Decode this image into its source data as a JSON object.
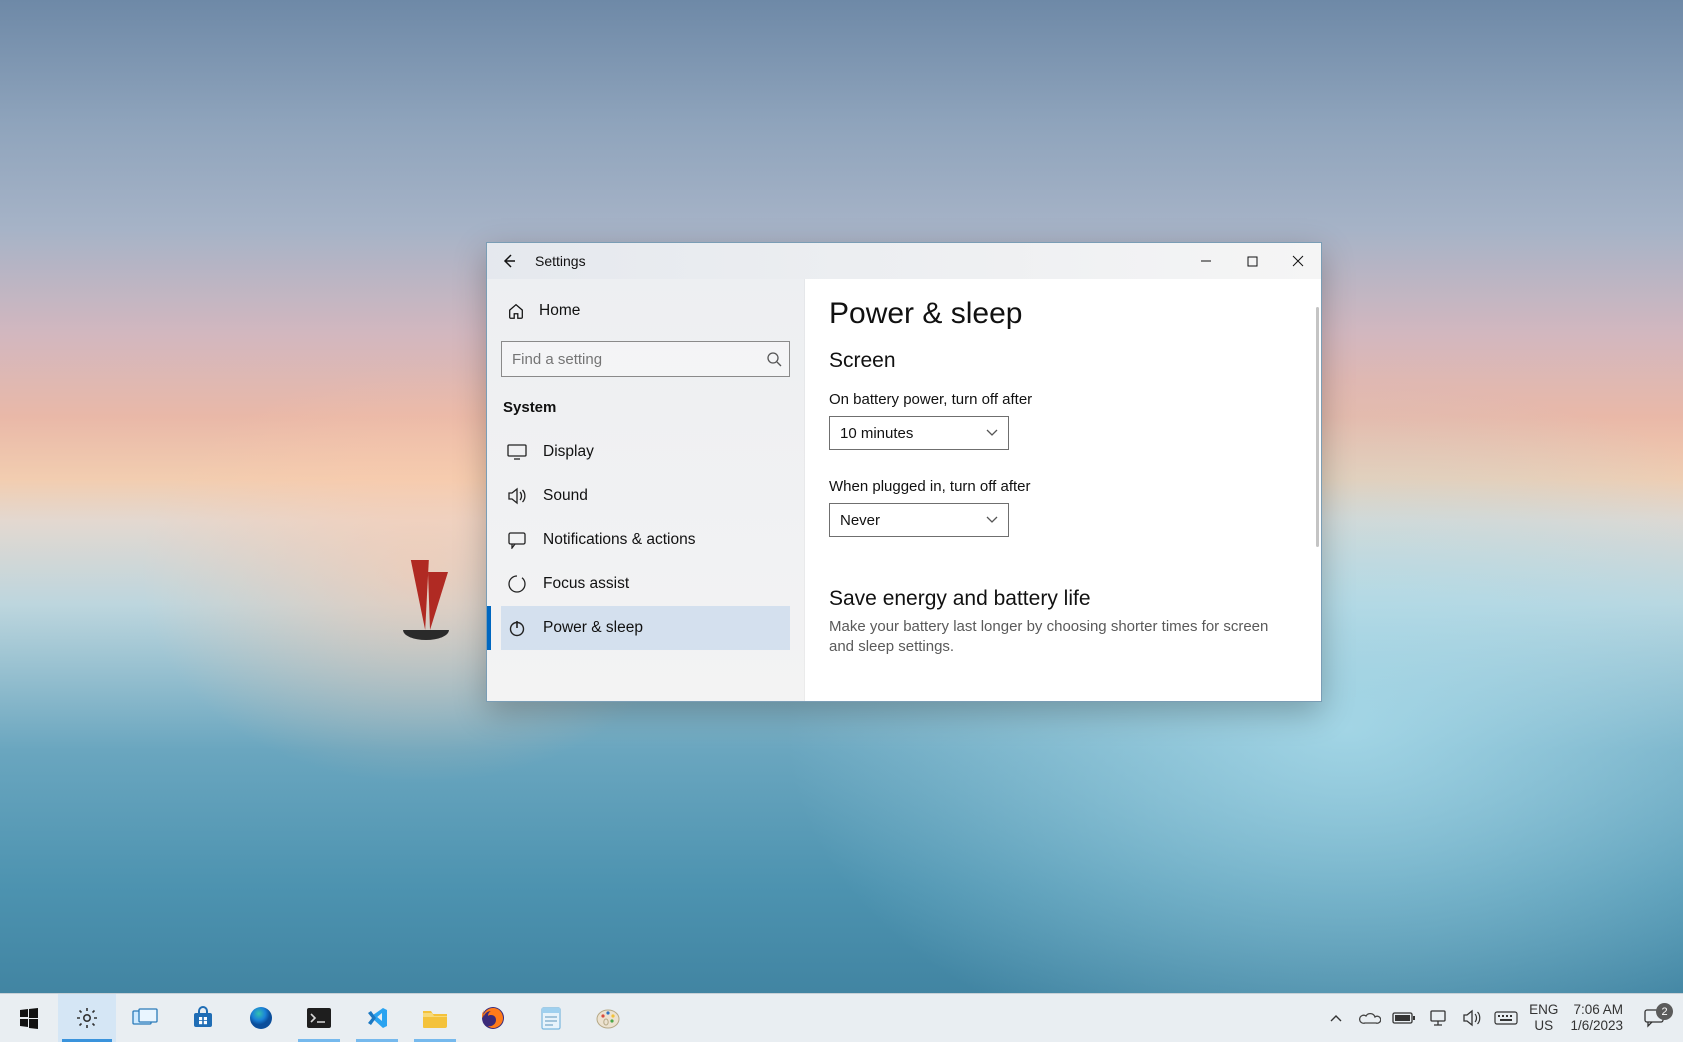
{
  "window": {
    "title": "Settings",
    "home_label": "Home",
    "search_placeholder": "Find a setting",
    "section_header": "System",
    "nav": [
      {
        "icon": "display",
        "label": "Display"
      },
      {
        "icon": "sound",
        "label": "Sound"
      },
      {
        "icon": "notifications",
        "label": "Notifications & actions"
      },
      {
        "icon": "focus",
        "label": "Focus assist"
      },
      {
        "icon": "power",
        "label": "Power & sleep"
      }
    ],
    "active_nav_index": 4
  },
  "page": {
    "title": "Power & sleep",
    "screen_header": "Screen",
    "battery_label": "On battery power, turn off after",
    "battery_value": "10 minutes",
    "plugged_label": "When plugged in, turn off after",
    "plugged_value": "Never",
    "energy_header": "Save energy and battery life",
    "energy_text": "Make your battery last longer by choosing shorter times for screen and sleep settings."
  },
  "taskbar": {
    "apps": [
      {
        "name": "start",
        "active": false
      },
      {
        "name": "settings",
        "active": true,
        "focused": true
      },
      {
        "name": "task-view",
        "active": false
      },
      {
        "name": "microsoft-store",
        "active": false
      },
      {
        "name": "edge",
        "active": false
      },
      {
        "name": "terminal",
        "active": true
      },
      {
        "name": "vscode",
        "active": true
      },
      {
        "name": "file-explorer",
        "active": true
      },
      {
        "name": "firefox",
        "active": false
      },
      {
        "name": "notepad",
        "active": false
      },
      {
        "name": "paint",
        "active": false
      }
    ],
    "tray_icons": [
      "chevron-up",
      "onedrive",
      "battery",
      "network",
      "volume",
      "keyboard"
    ],
    "language_top": "ENG",
    "language_bottom": "US",
    "time": "7:06 AM",
    "date": "1/6/2023",
    "notification_count": "2"
  }
}
